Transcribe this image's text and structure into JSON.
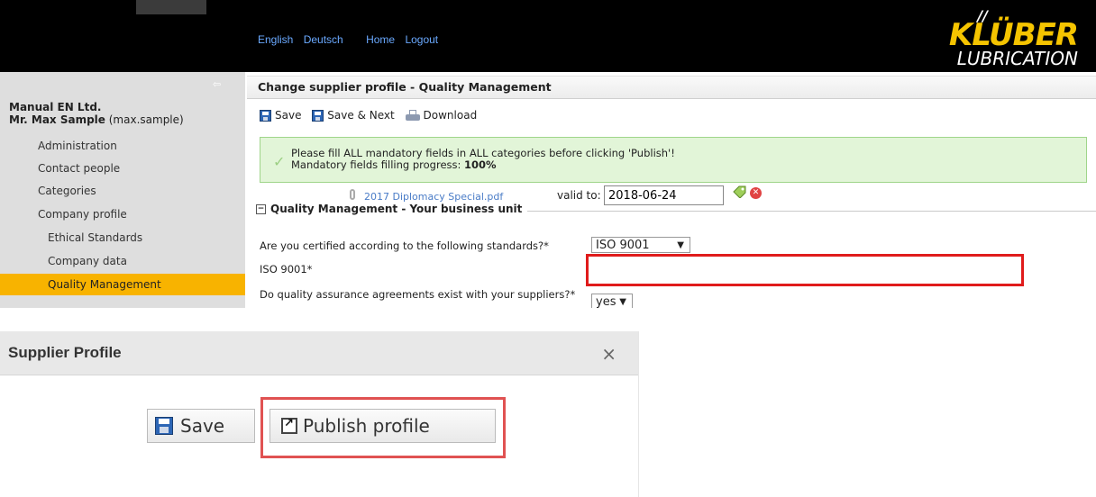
{
  "topnav": {
    "lang_english": "English",
    "lang_deutsch": "Deutsch",
    "home": "Home",
    "logout": "Logout"
  },
  "logo": {
    "mark": "//",
    "brand": "KLÜBER",
    "sub": "LUBRICATION"
  },
  "sidebar": {
    "company": "Manual EN Ltd.",
    "person_name": "Mr. Max Sample",
    "person_login": " (max.sample)",
    "items": [
      {
        "label": "Administration"
      },
      {
        "label": "Contact people"
      },
      {
        "label": "Categories"
      },
      {
        "label": "Company profile"
      },
      {
        "label": "Ethical Standards"
      },
      {
        "label": "Company data"
      },
      {
        "label": "Quality Management"
      }
    ]
  },
  "main": {
    "title": "Change supplier profile - Quality Management",
    "toolbar": {
      "save": "Save",
      "save_next": "Save & Next",
      "download": "Download"
    },
    "message": {
      "line1": "Please fill ALL mandatory fields in ALL categories before clicking 'Publish'!",
      "line2_label": "Mandatory fields filling progress: ",
      "line2_value": "100%"
    },
    "section": {
      "legend": "Quality Management - Your business unit",
      "q1": "Are you certified according to the following standards?*",
      "q1_value": "ISO 9001",
      "q2": "ISO 9001*",
      "file_name": "2017 Diplomacy Special.pdf",
      "valid_label": "valid to:",
      "valid_value": "2018-06-24",
      "q3": "Do quality assurance agreements exist with your suppliers?*",
      "q3_value": "yes"
    }
  },
  "dialog": {
    "title": "Supplier Profile",
    "close": "×",
    "save": "Save",
    "publish": "Publish profile"
  }
}
